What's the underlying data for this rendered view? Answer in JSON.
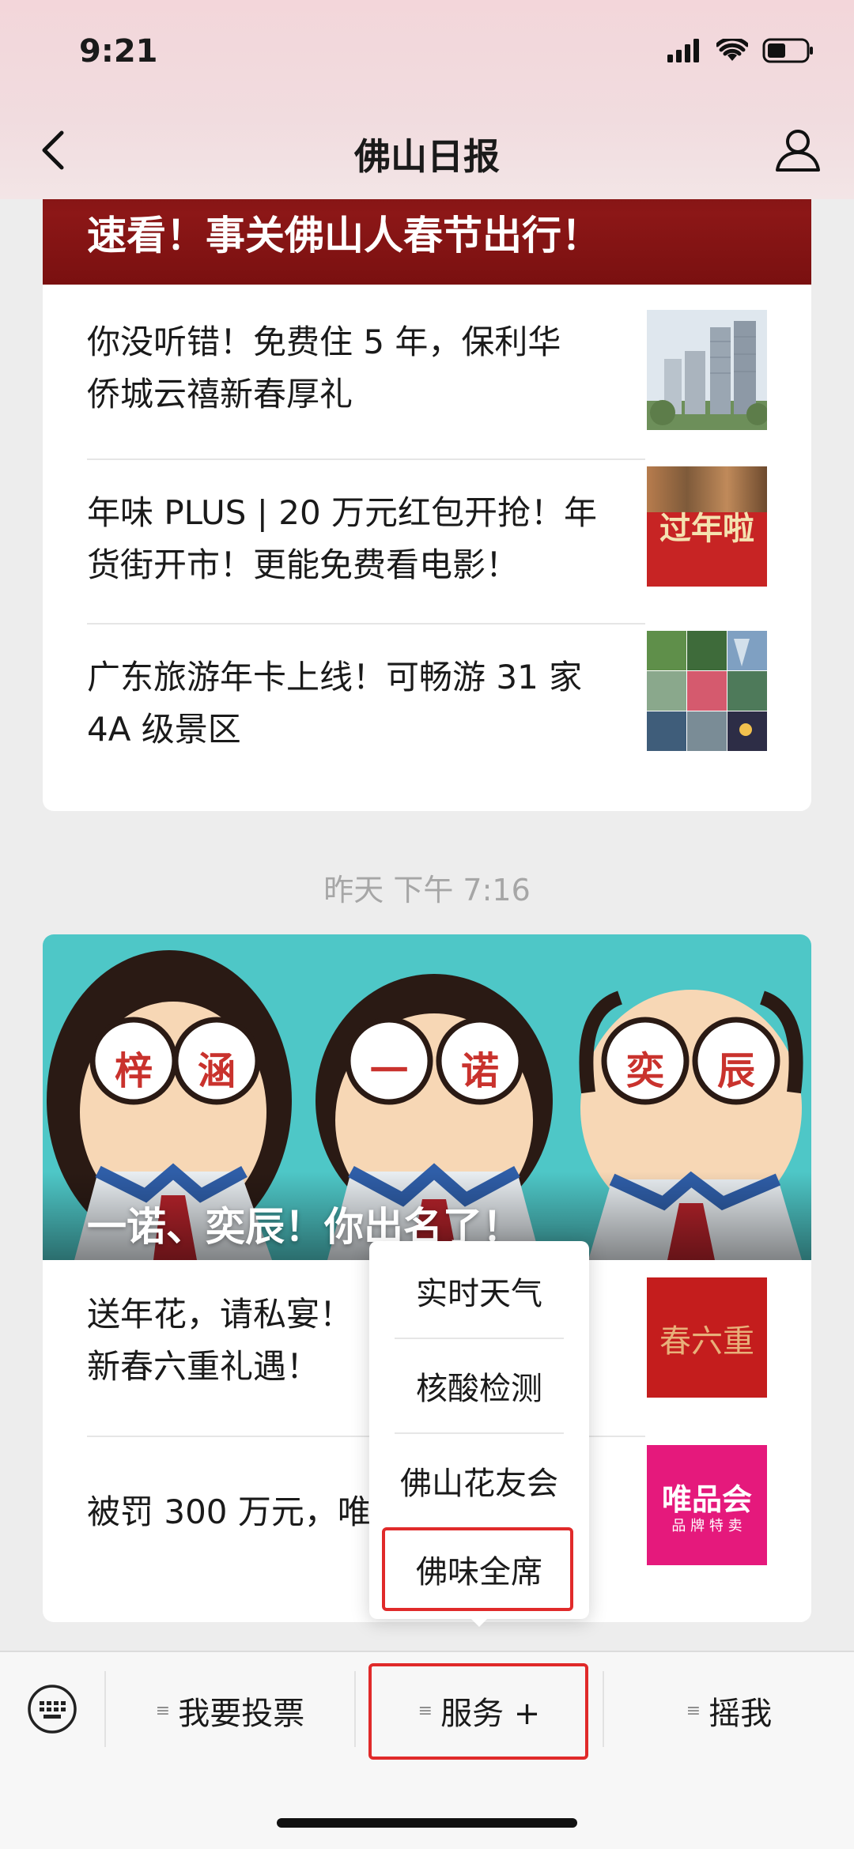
{
  "status": {
    "time": "9:21"
  },
  "nav": {
    "title": "佛山日报"
  },
  "article_group_1": {
    "banner_title": "速看！事关佛山人春节出行！",
    "items": [
      {
        "title_line1": "你没听错！免费住 5 年，保利华",
        "title_line2": "侨城云禧新春厚礼"
      },
      {
        "title_line1": "年味 PLUS | 20 万元红包开抢！年",
        "title_line2": "货街开市！更能免费看电影！",
        "thumb_text": "过年啦"
      },
      {
        "title_line1": "广东旅游年卡上线！可畅游 31 家",
        "title_line2": "4A 级景区"
      }
    ]
  },
  "timestamp": "昨天 下午 7:16",
  "article_group_2": {
    "banner_title": "一诺、奕辰！你出名了！",
    "glasses_chars": [
      "梓",
      "涵",
      "一",
      "诺",
      "奕",
      "辰"
    ],
    "items": [
      {
        "title_line1": "送年花，请私宴！",
        "title_line2": "新春六重礼遇！",
        "thumb_text": "春六重"
      },
      {
        "title_line1": "被罚 300 万元，唯",
        "thumb_text_1": "唯品会",
        "thumb_text_2": "品 牌 特 卖"
      }
    ]
  },
  "popup_menu": {
    "items": [
      "实时天气",
      "核酸检测",
      "佛山花友会",
      "佛味全席"
    ],
    "highlighted_index": 3
  },
  "bottom_menu": {
    "items": [
      "我要投票",
      "服务 +",
      "摇我"
    ],
    "menu_glyph": "≡"
  },
  "colors": {
    "highlight_border": "#e02a2a",
    "banner_red": "#8c1717",
    "illustration_bg": "#4ec7c7"
  }
}
